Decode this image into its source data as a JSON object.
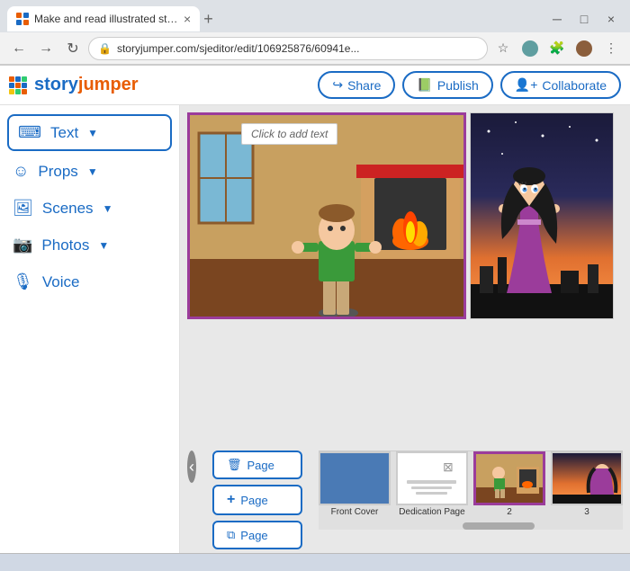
{
  "browser": {
    "tab_title": "Make and read illustrated story b",
    "url": "storyjumper.com/sjeditor/edit/106925876/60941e...",
    "new_tab_label": "+"
  },
  "header": {
    "logo_text": "story",
    "logo_text2": "jumper",
    "share_label": "Share",
    "publish_label": "Publish",
    "collaborate_label": "Collaborate"
  },
  "sidebar": {
    "items": [
      {
        "id": "text",
        "label": "Text",
        "icon": "⌨",
        "has_arrow": true
      },
      {
        "id": "props",
        "label": "Props",
        "icon": "☺",
        "has_arrow": true
      },
      {
        "id": "scenes",
        "label": "Scenes",
        "icon": "🖼",
        "has_arrow": true
      },
      {
        "id": "photos",
        "label": "Photos",
        "icon": "📷",
        "has_arrow": true
      },
      {
        "id": "voice",
        "label": "Voice",
        "icon": "🎙",
        "has_arrow": false
      }
    ]
  },
  "canvas": {
    "click_to_add_text": "Click to add text"
  },
  "page_buttons": [
    {
      "id": "delete-page",
      "label": "Page",
      "icon": "🗑"
    },
    {
      "id": "add-page",
      "label": "Page",
      "icon": "+"
    },
    {
      "id": "duplicate-page",
      "label": "Page",
      "icon": "⧉"
    }
  ],
  "thumbnails": [
    {
      "id": "front-cover",
      "label": "Front Cover",
      "type": "blue"
    },
    {
      "id": "dedication",
      "label": "Dedication Page",
      "type": "white"
    },
    {
      "id": "page2",
      "label": "2",
      "type": "scene"
    },
    {
      "id": "page3",
      "label": "3",
      "type": "girl"
    }
  ]
}
